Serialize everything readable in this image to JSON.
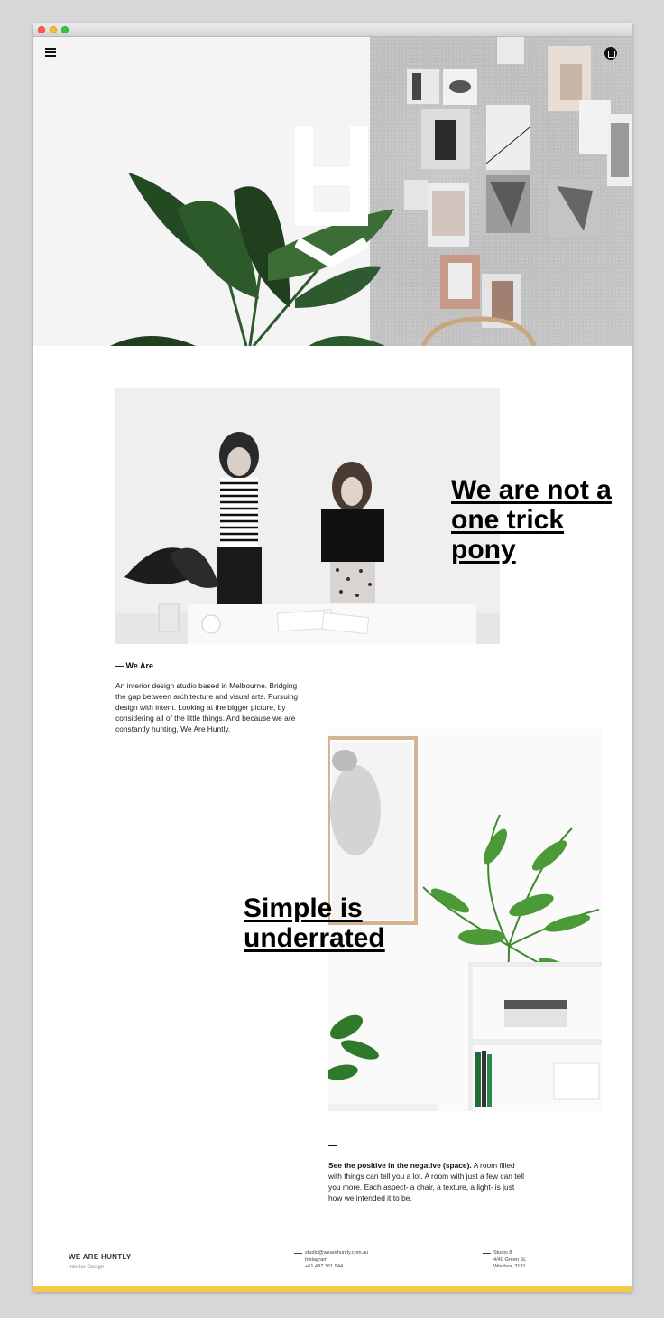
{
  "window": {
    "controls": [
      "close",
      "minimize",
      "zoom"
    ]
  },
  "hero": {
    "menu_icon": "hamburger-icon",
    "social_icon": "instagram-icon",
    "logo": "H"
  },
  "intro": {
    "headline": "We are not a one trick pony",
    "label": "— We Are",
    "text": "An interior design studio based in Melbourne. Bridging the gap between architecture and visual arts. Pursuing design with intent. Looking at the bigger picture, by considering all of the little things. And because we are constantly hunting, We Are Huntly."
  },
  "feature": {
    "headline": "Simple is underrated",
    "lead": "See the positive in the negative (space).",
    "text": " A room filled with things can tell you a lot. A room with just a few can tell you more. Each aspect- a chair, a texture, a light- is just how we intended it to be."
  },
  "footer": {
    "brand": "WE ARE HUNTLY",
    "sub": "Interior Design",
    "email": "studio@wearehuntly.com.au",
    "instagram": "Instagram",
    "phone": "+61 487 361 544",
    "address_1": "Studio 8",
    "address_2": "4/40 Green St,",
    "address_3": "Windsor, 3181"
  },
  "colors": {
    "accent": "#f4c84b",
    "text": "#111111",
    "background": "#ffffff"
  }
}
